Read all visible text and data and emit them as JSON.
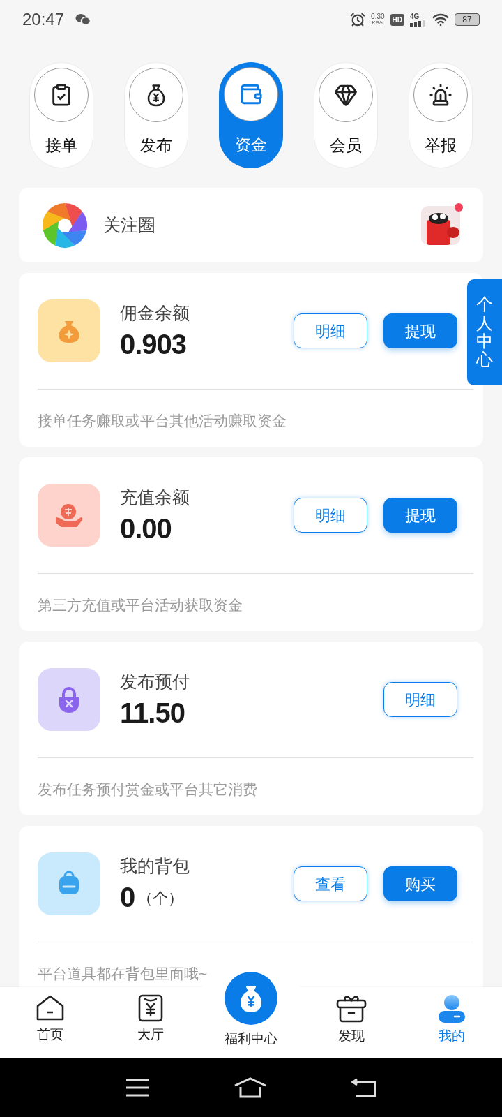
{
  "status_bar": {
    "time": "20:47",
    "net_speed": "0.30",
    "net_unit": "KB/s",
    "hd": "HD",
    "network": "4G",
    "battery": "87"
  },
  "tabs": [
    {
      "kind": "orders",
      "label": "接单",
      "selected": false
    },
    {
      "kind": "publish",
      "label": "发布",
      "selected": false
    },
    {
      "kind": "funds",
      "label": "资金",
      "selected": true
    },
    {
      "kind": "member",
      "label": "会员",
      "selected": false
    },
    {
      "kind": "report",
      "label": "举报",
      "selected": false
    }
  ],
  "follow_circle": {
    "label": "关注圈",
    "unread": true
  },
  "side_tab": {
    "label": "个人中心"
  },
  "cards": [
    {
      "kind": "commission",
      "title": "佣金余额",
      "amount": "0.903",
      "buttons": [
        {
          "label": "明细",
          "primary": false
        },
        {
          "label": "提现",
          "primary": true
        }
      ],
      "description": "接单任务赚取或平台其他活动赚取资金"
    },
    {
      "kind": "recharge",
      "title": "充值余额",
      "amount": "0.00",
      "buttons": [
        {
          "label": "明细",
          "primary": false
        },
        {
          "label": "提现",
          "primary": true
        }
      ],
      "description": "第三方充值或平台活动获取资金"
    },
    {
      "kind": "prepay",
      "title": "发布预付",
      "amount": "11.50",
      "buttons": [
        {
          "label": "明细",
          "primary": false
        }
      ],
      "description": "发布任务预付赏金或平台其它消费"
    },
    {
      "kind": "backpack",
      "title": "我的背包",
      "amount": "0",
      "unit": "（个）",
      "buttons": [
        {
          "label": "查看",
          "primary": false
        },
        {
          "label": "购买",
          "primary": true
        }
      ],
      "description": "平台道具都在背包里面哦~"
    }
  ],
  "bottom_nav": [
    {
      "kind": "home",
      "label": "首页",
      "selected": false
    },
    {
      "kind": "hall",
      "label": "大厅",
      "selected": false
    },
    {
      "kind": "welfare",
      "label": "福利中心",
      "selected": false
    },
    {
      "kind": "discover",
      "label": "发现",
      "selected": false
    },
    {
      "kind": "me",
      "label": "我的",
      "selected": true
    }
  ]
}
